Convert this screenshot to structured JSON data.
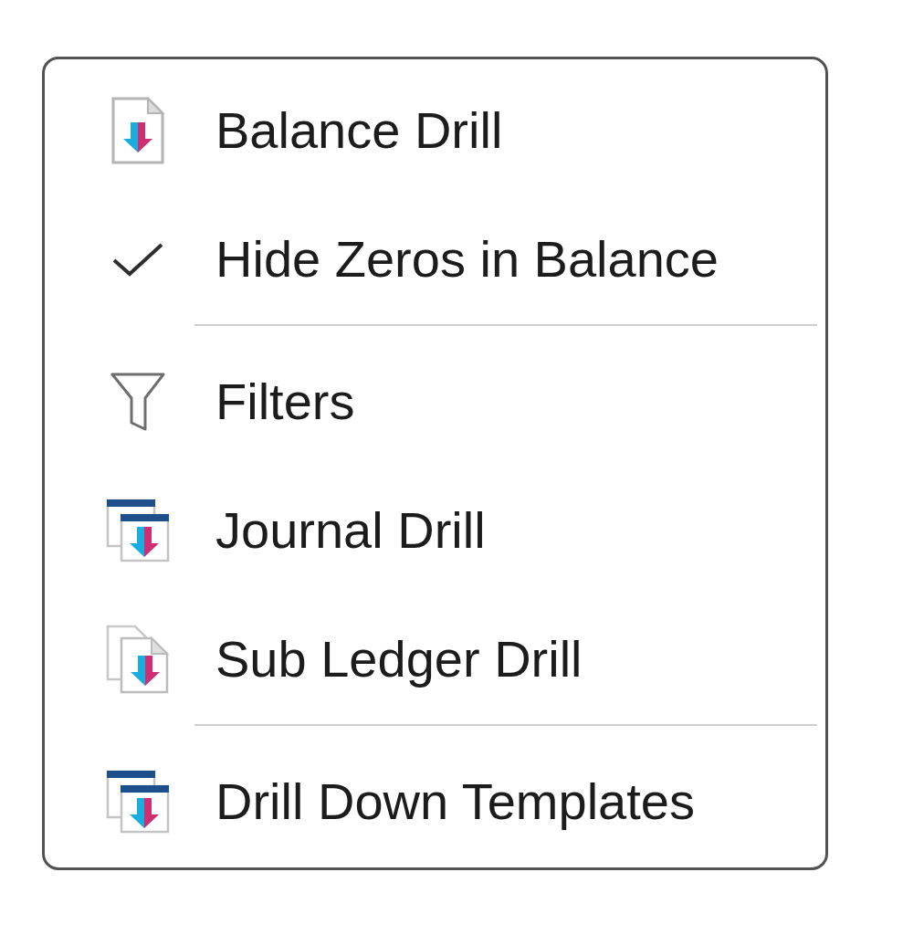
{
  "menu": {
    "groups": [
      {
        "items": [
          {
            "label": "Balance Drill",
            "checked": false
          },
          {
            "label": "Hide Zeros in Balance",
            "checked": true
          }
        ]
      },
      {
        "items": [
          {
            "label": "Filters",
            "checked": false
          },
          {
            "label": "Journal Drill",
            "checked": false
          },
          {
            "label": "Sub Ledger Drill",
            "checked": false
          }
        ]
      },
      {
        "items": [
          {
            "label": "Drill Down Templates",
            "checked": false
          }
        ]
      }
    ]
  }
}
